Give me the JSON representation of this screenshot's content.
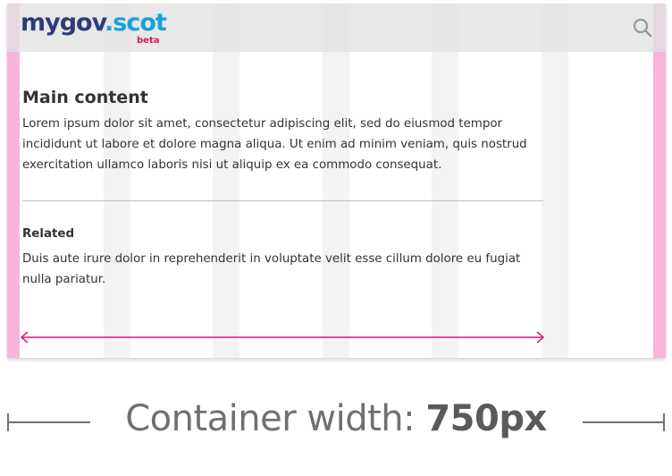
{
  "colors": {
    "gutter": "#f7b5d9",
    "grid_column": "#f3f3f3",
    "header_overlay": "#e1e1e1",
    "logo_primary": "#2c3e78",
    "logo_accent": "#1aa0d8",
    "beta": "#d6195b",
    "arrow": "#d6197e",
    "caption": "#707070"
  },
  "header": {
    "logo_my": "mygov",
    "logo_dot_scot": ".scot",
    "logo_beta": "beta",
    "search_icon": "search-icon"
  },
  "main": {
    "title": "Main content",
    "body": "Lorem ipsum dolor sit amet, consectetur adipiscing elit, sed do eiusmod tempor incididunt ut labore et dolore magna aliqua. Ut enim ad minim veniam, quis nostrud exercitation ullamco laboris nisi ut aliquip ex ea commodo consequat."
  },
  "related": {
    "heading": "Related",
    "body": "Duis aute irure dolor in reprehenderit in voluptate velit esse cillum dolore eu fugiat nulla pariatur."
  },
  "caption": {
    "label": "Container width: ",
    "value": "750px"
  }
}
